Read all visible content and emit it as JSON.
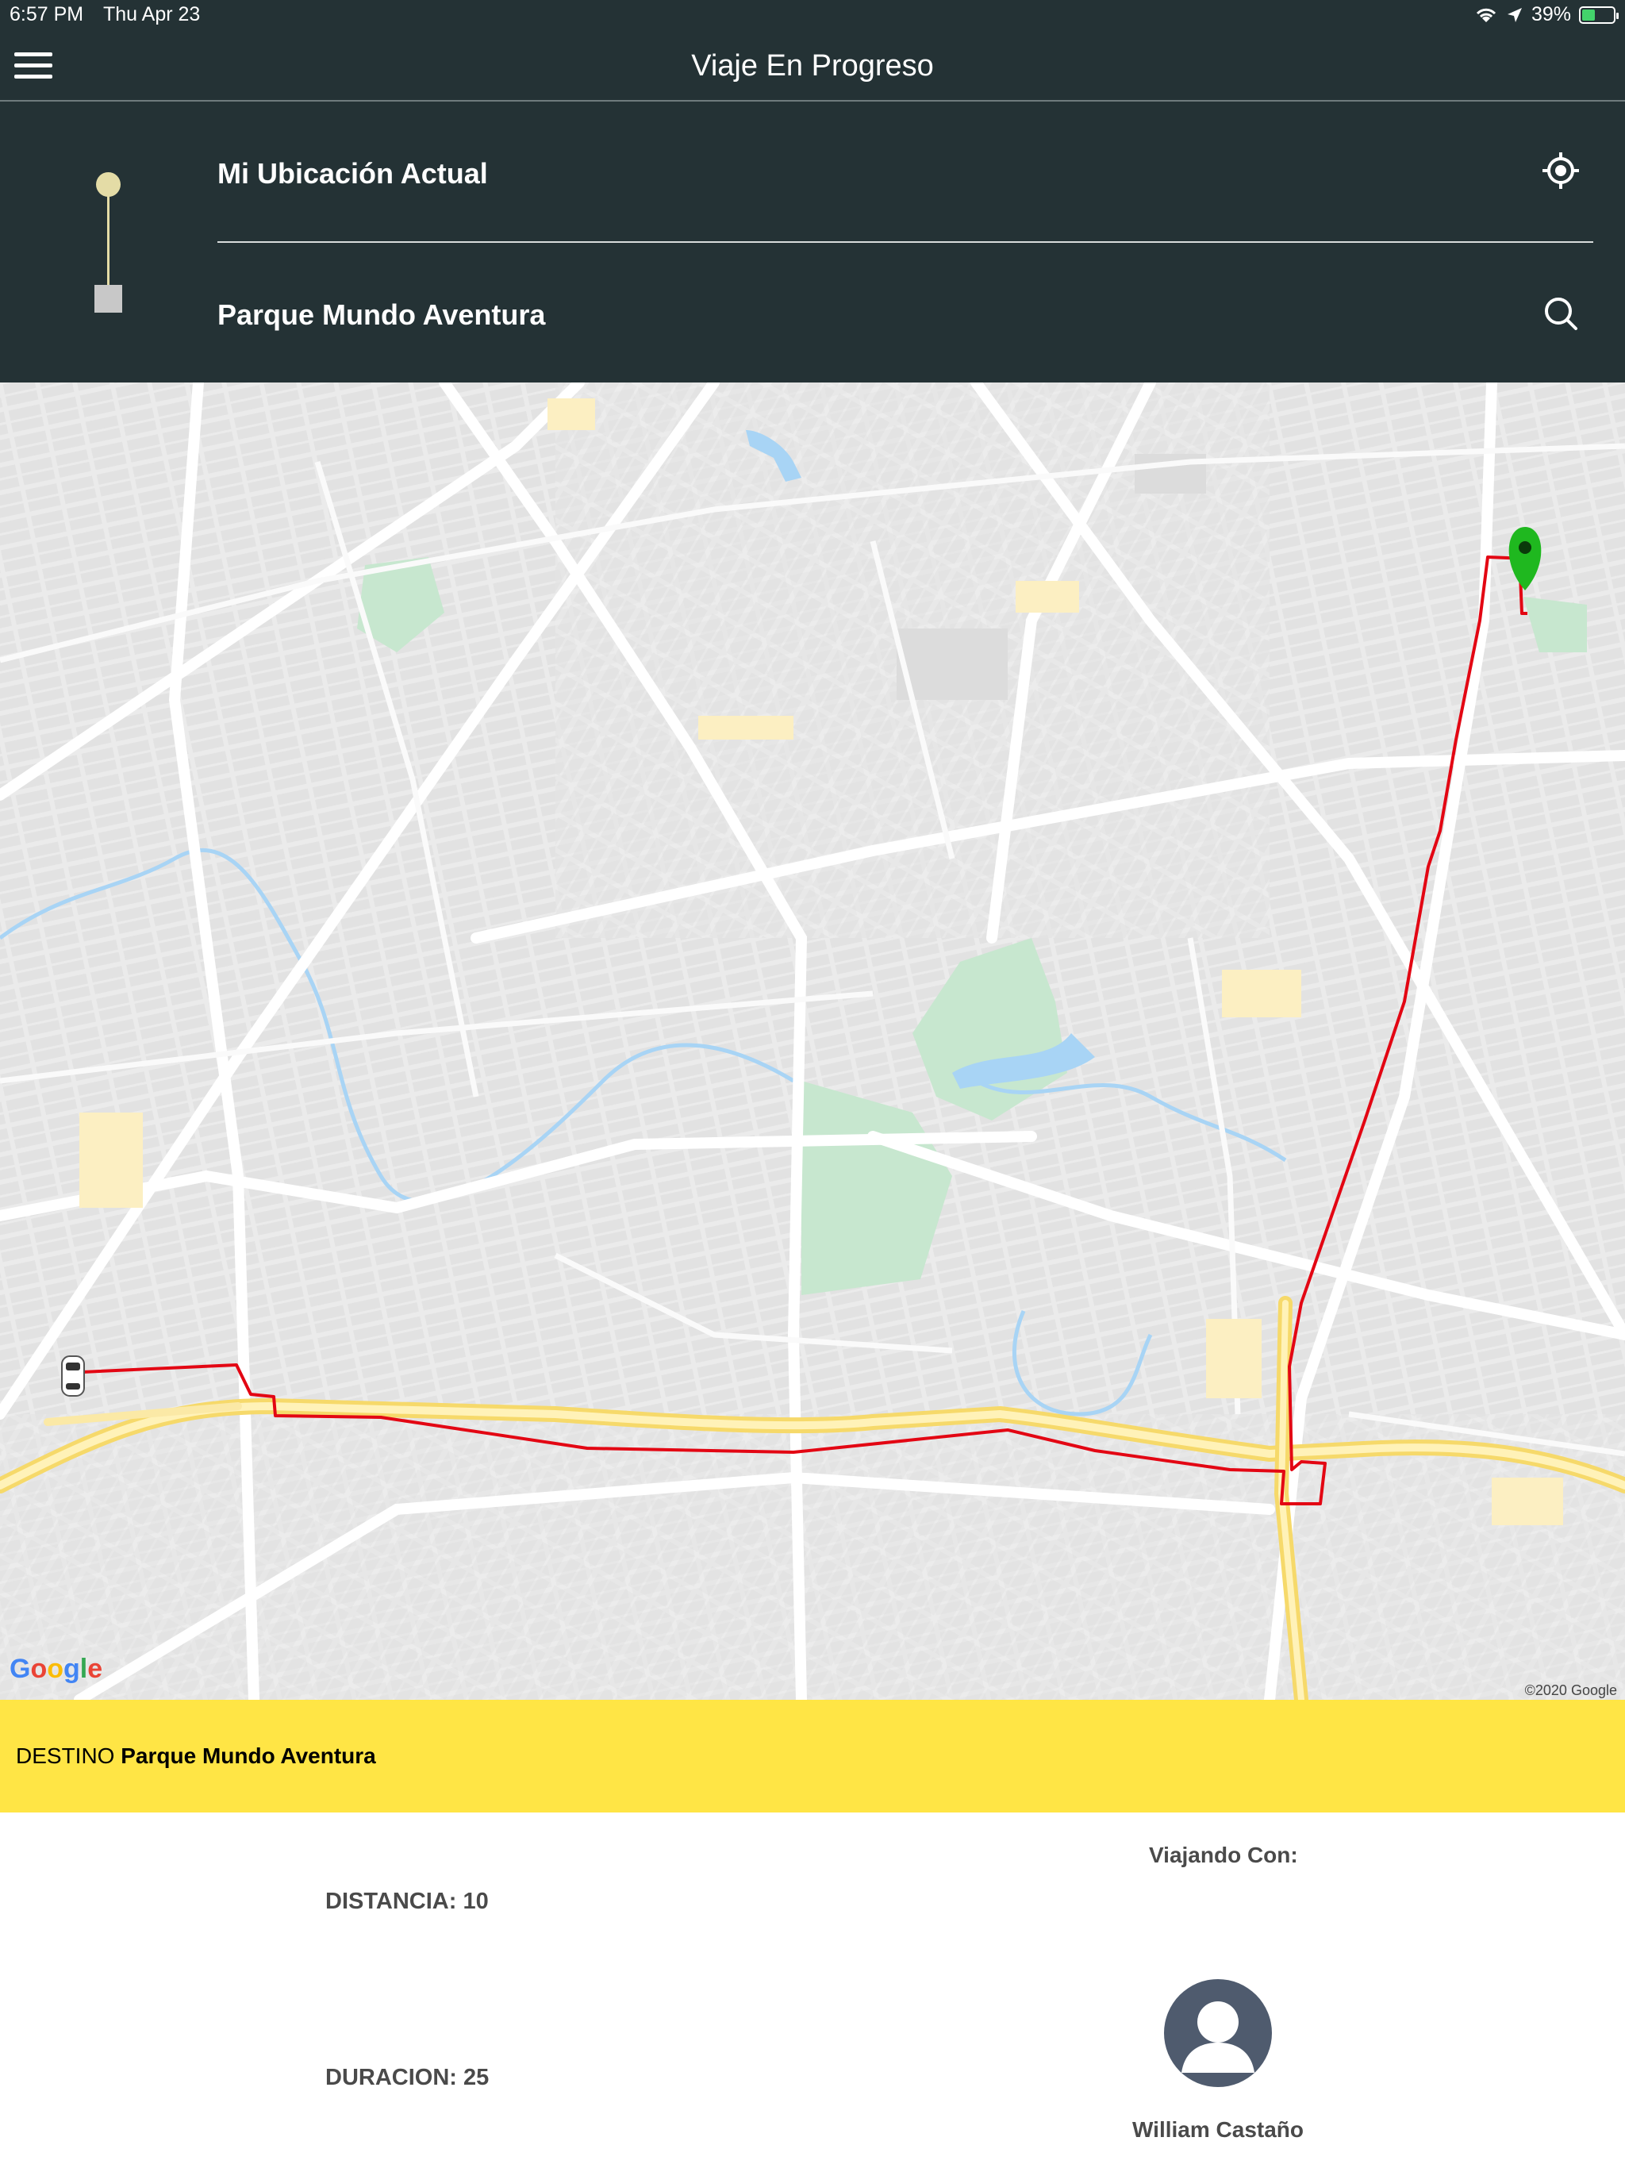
{
  "status_bar": {
    "time": "6:57 PM",
    "date": "Thu Apr 23",
    "battery": "39%",
    "icons": [
      "wifi-icon",
      "location-arrow-icon",
      "battery-charging-icon"
    ]
  },
  "header": {
    "title": "Viaje En Progreso",
    "menu_icon": "hamburger-menu-icon"
  },
  "route": {
    "origin": "Mi Ubicación Actual",
    "origin_icon": "my-location-icon",
    "destination": "Parque Mundo Aventura",
    "destination_icon": "search-icon"
  },
  "map": {
    "provider_logo": "Google",
    "copyright": "©2020 Google",
    "route_color": "#e30613",
    "destination_marker_color": "#1fb81f",
    "markers": [
      "car-marker-icon",
      "destination-pin-icon"
    ]
  },
  "destination_bar": {
    "label": "DESTINO",
    "value": "Parque Mundo Aventura",
    "background": "#ffe545"
  },
  "trip_info": {
    "distance": "DISTANCIA: 10",
    "duration": "DURACION: 25",
    "traveling_with_label": "Viajando Con:",
    "driver_name": "William Castaño",
    "avatar_icon": "user-avatar-icon"
  }
}
